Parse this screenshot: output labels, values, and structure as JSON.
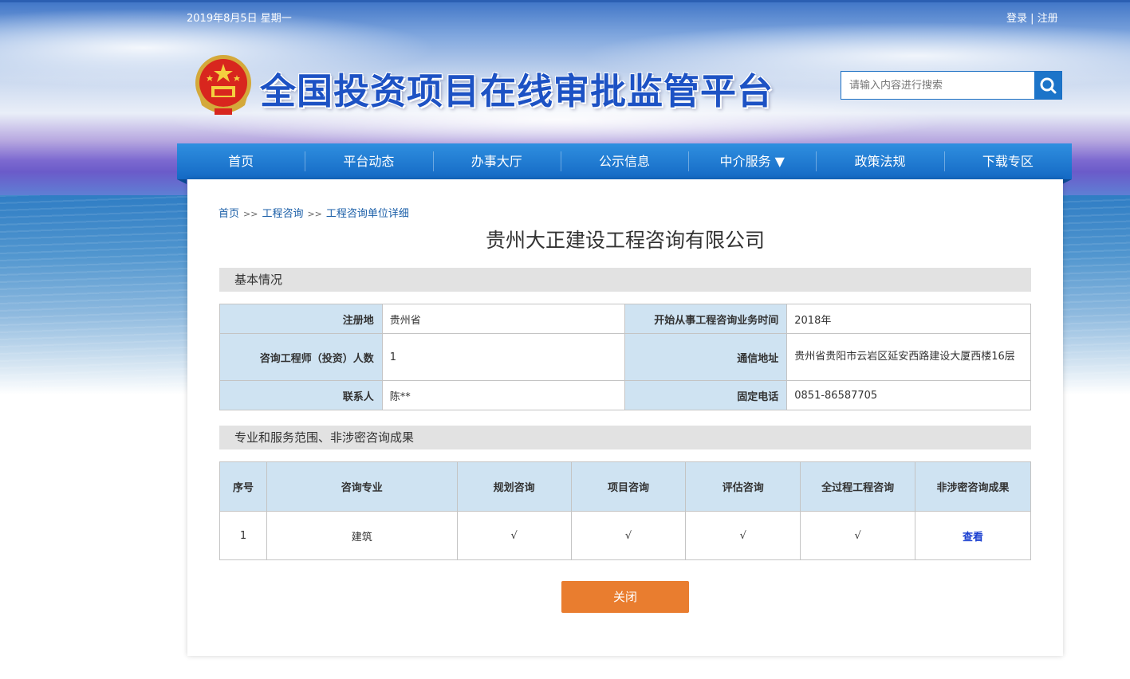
{
  "header": {
    "date": "2019年8月5日 星期一",
    "login": "登录",
    "separator": "|",
    "register": "注册",
    "site_title": "全国投资项目在线审批监管平台",
    "search_placeholder": "请输入内容进行搜索"
  },
  "nav": {
    "items": [
      "首页",
      "平台动态",
      "办事大厅",
      "公示信息",
      "中介服务 ▼",
      "政策法规",
      "下载专区"
    ]
  },
  "breadcrumb": {
    "items": [
      "首页",
      "工程咨询",
      "工程咨询单位详细"
    ],
    "sep": ">>"
  },
  "company_name": "贵州大正建设工程咨询有限公司",
  "basic": {
    "section_title": "基本情况",
    "rows": [
      {
        "k1": "注册地",
        "v1": "贵州省",
        "k2": "开始从事工程咨询业务时间",
        "v2": "2018年"
      },
      {
        "k1": "咨询工程师（投资）人数",
        "v1": "1",
        "k2": "通信地址",
        "v2": "贵州省贵阳市云岩区延安西路建设大厦西楼16层"
      },
      {
        "k1": "联系人",
        "v1": "陈**",
        "k2": "固定电话",
        "v2": "0851-86587705"
      }
    ]
  },
  "services": {
    "section_title": "专业和服务范围、非涉密咨询成果",
    "headers": [
      "序号",
      "咨询专业",
      "规划咨询",
      "项目咨询",
      "评估咨询",
      "全过程工程咨询",
      "非涉密咨询成果"
    ],
    "rows": [
      {
        "index": "1",
        "major": "建筑",
        "planning": "√",
        "project": "√",
        "evaluation": "√",
        "whole": "√",
        "results": "查看"
      }
    ]
  },
  "close_label": "关闭",
  "colors": {
    "nav": "#1c74c9",
    "title": "#1d52c4",
    "table_header": "#cfe3f2",
    "close_button": "#e97d2f"
  }
}
